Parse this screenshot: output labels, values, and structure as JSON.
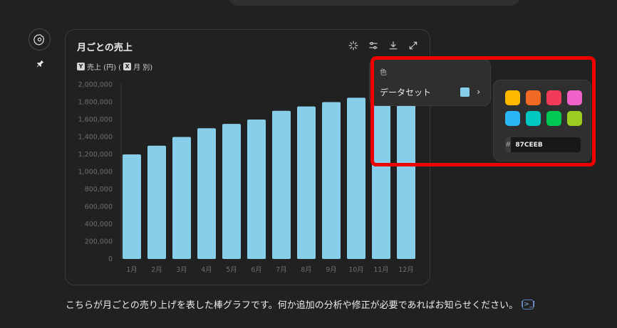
{
  "chart_card": {
    "title": "月ごとの売上",
    "legend": {
      "y_key": "Y",
      "y_label": "売上 (円) (",
      "x_key": "X",
      "x_label": "月 別)"
    },
    "tools": [
      "sparkle-icon",
      "sliders-icon",
      "download-icon",
      "expand-icon"
    ]
  },
  "chart_data": {
    "type": "bar",
    "categories": [
      "1月",
      "2月",
      "3月",
      "4月",
      "5月",
      "6月",
      "7月",
      "8月",
      "9月",
      "10月",
      "11月",
      "12月"
    ],
    "values": [
      1200000,
      1300000,
      1400000,
      1500000,
      1550000,
      1600000,
      1700000,
      1750000,
      1800000,
      1850000,
      1900000,
      2000000
    ],
    "ylim": [
      0,
      2000000
    ],
    "yticks": [
      "0",
      "200,000",
      "400,000",
      "600,000",
      "800,000",
      "1,000,000",
      "1,200,000",
      "1,400,000",
      "1,600,000",
      "1,800,000",
      "2,000,000"
    ],
    "color": "#87CEEB",
    "grid": false
  },
  "menu": {
    "header": "色",
    "item_label": "データセット",
    "current_color": "#87CEEB",
    "chevron": "›"
  },
  "palette": {
    "colors": [
      "#FFB800",
      "#F06A24",
      "#F23B5B",
      "#F062C8",
      "#29B6F6",
      "#00C8C0",
      "#00C853",
      "#9CCC20"
    ],
    "hash": "#",
    "hex_value": "87CEEB"
  },
  "message": {
    "text": "こちらが月ごとの売り上げを表した棒グラフです。何か追加の分析や修正が必要であればお知らせください。",
    "cite_glyph": "[>_]"
  },
  "annotation_color": "#EE0000"
}
